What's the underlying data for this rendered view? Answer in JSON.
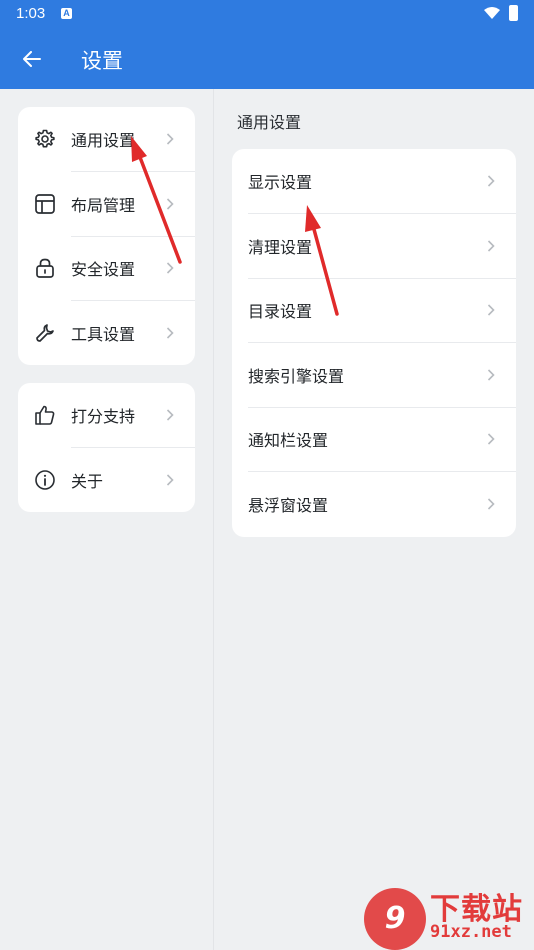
{
  "status_bar": {
    "time": "1:03",
    "notification_icon": "A"
  },
  "app_bar": {
    "title": "设置",
    "back_icon": "arrow-left-icon"
  },
  "sidebar": {
    "group1": [
      {
        "label": "通用设置",
        "icon": "gear-icon"
      },
      {
        "label": "布局管理",
        "icon": "layout-icon"
      },
      {
        "label": "安全设置",
        "icon": "lock-icon"
      },
      {
        "label": "工具设置",
        "icon": "wrench-icon"
      }
    ],
    "group2": [
      {
        "label": "打分支持",
        "icon": "thumbs-up-icon"
      },
      {
        "label": "关于",
        "icon": "info-icon"
      }
    ]
  },
  "main": {
    "section_title": "通用设置",
    "items": [
      {
        "label": "显示设置"
      },
      {
        "label": "清理设置"
      },
      {
        "label": "目录设置"
      },
      {
        "label": "搜索引擎设置"
      },
      {
        "label": "通知栏设置"
      },
      {
        "label": "悬浮窗设置"
      }
    ]
  },
  "watermark": {
    "logo_text": "9",
    "cn": "下载站",
    "en": "91xz.net"
  },
  "colors": {
    "accent": "#2f7be0",
    "annotation_arrow": "#e02a2a",
    "background": "#eef0f2"
  }
}
